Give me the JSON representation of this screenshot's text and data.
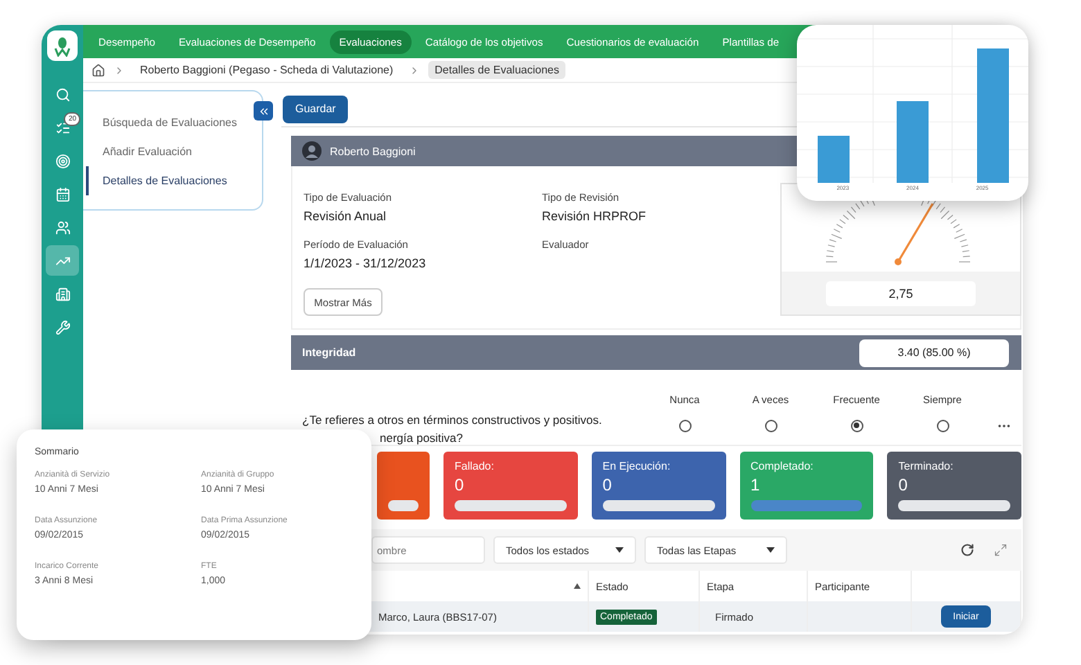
{
  "rail_items": [
    {
      "kind": "search",
      "selected": false
    },
    {
      "kind": "tasks",
      "selected": false,
      "badge": "20"
    },
    {
      "kind": "goals",
      "selected": false
    },
    {
      "kind": "calendar",
      "selected": false
    },
    {
      "kind": "people",
      "selected": false
    },
    {
      "kind": "analytics",
      "selected": true
    },
    {
      "kind": "company",
      "selected": false
    },
    {
      "kind": "tools",
      "selected": false
    }
  ],
  "nav_tabs": [
    {
      "label": "Desempeño",
      "selected": false
    },
    {
      "label": "Evaluaciones de Desempeño",
      "selected": false
    },
    {
      "label": "Evaluaciones",
      "selected": true
    },
    {
      "label": "Catálogo de los objetivos",
      "selected": false
    },
    {
      "label": "Cuestionarios de evaluación",
      "selected": false
    },
    {
      "label": "Plantillas de",
      "selected": false
    }
  ],
  "breadcrumb": [
    {
      "label": "Roberto Baggioni (Pegaso - Scheda di Valutazione)",
      "current": false
    },
    {
      "label": "Detalles de Evaluaciones",
      "current": true
    }
  ],
  "side_menu": [
    {
      "label": "Búsqueda de Evaluaciones",
      "selected": false
    },
    {
      "label": "Añadir Evaluación",
      "selected": false
    },
    {
      "label": "Detalles de Evaluaciones",
      "selected": true
    }
  ],
  "save_button": "Guardar",
  "profile": {
    "name": "Roberto Baggioni"
  },
  "details": [
    {
      "label": "Tipo de Evaluación",
      "value": "Revisión Anual"
    },
    {
      "label": "Tipo de Revisión",
      "value": "Revisión HRPROF"
    },
    {
      "label": "Período de Evaluación",
      "value": "1/1/2023 - 31/12/2023"
    },
    {
      "label": "Evaluador"
    }
  ],
  "more_button": "Mostrar Más",
  "gauge": {
    "reading": "2,75"
  },
  "section": {
    "title": "Integridad",
    "score": "3.40 (85.00 %)"
  },
  "question": {
    "lines": [
      "¿Te refieres a otros en términos constructivos y positivos.",
      "nergía positiva?"
    ],
    "options": [
      {
        "label": "Nunca",
        "selected": false
      },
      {
        "label": "A veces",
        "selected": false
      },
      {
        "label": "Frecuente",
        "selected": true
      },
      {
        "label": "Siempre",
        "selected": false
      }
    ]
  },
  "status_cards": [
    {
      "color": "#e8521f",
      "level": 0
    },
    {
      "label": "Fallado:",
      "count": "0",
      "color": "#e64640",
      "level": 0
    },
    {
      "label": "En Ejecución:",
      "count": "0",
      "color": "#3d64ad",
      "level": 0
    },
    {
      "label": "Completado:",
      "count": "1",
      "color": "#2aa866",
      "level": 1
    },
    {
      "label": "Terminado:",
      "count": "0",
      "color": "#545a66",
      "level": 0
    }
  ],
  "filters": {
    "search_placeholder": "ombre",
    "dropdowns": [
      "Todos los estados",
      "Todas las Etapas"
    ]
  },
  "table": {
    "columns": [
      {
        "sorted": true
      },
      {
        "label": "Estado",
        "sorted": false
      },
      {
        "label": "Etapa",
        "sorted": false
      },
      {
        "label": "Participante",
        "sorted": false
      }
    ],
    "rows": [
      {
        "name": "Marco, Laura (BBS17-07)",
        "status": "Completado",
        "stage": "Firmado",
        "action": "Iniciar"
      }
    ]
  },
  "summary": {
    "title": "Sommario",
    "fields": [
      {
        "label": "Anzianità di Servizio",
        "value": "10 Anni 7 Mesi"
      },
      {
        "label": "Anzianità di Gruppo",
        "value": "10 Anni 7 Mesi"
      },
      {
        "label": "Data Assunzione",
        "value": "09/02/2015"
      },
      {
        "label": "Data Prima Assunzione",
        "value": "09/02/2015"
      },
      {
        "label": "Incarico Corrente",
        "value": "3 Anni 8 Mesi"
      },
      {
        "label": "FTE",
        "value": "1,000"
      }
    ]
  },
  "chart_card": {
    "labels": [
      "2023",
      "2024",
      "2025"
    ]
  }
}
